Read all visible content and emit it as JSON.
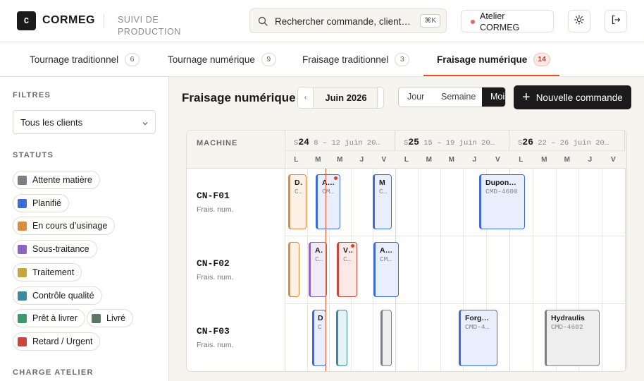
{
  "header": {
    "logo_letter": "C",
    "brand": "CORMEG",
    "subtitle_line1": "SUIVI DE",
    "subtitle_line2": "PRODUCTION",
    "search_placeholder": "Rechercher commande, client…",
    "search_shortcut": "⌘K",
    "workshop_line1": "Atelier",
    "workshop_line2": "CORMEG",
    "icons": [
      "search-icon",
      "sun-icon",
      "logout-icon"
    ]
  },
  "tabs": [
    {
      "label": "Tournage traditionnel",
      "count": "6",
      "active": false
    },
    {
      "label": "Tournage numérique",
      "count": "9",
      "active": false
    },
    {
      "label": "Fraisage traditionnel",
      "count": "3",
      "active": false
    },
    {
      "label": "Fraisage numérique",
      "count": "14",
      "active": true
    }
  ],
  "sidebar": {
    "filters_title": "FILTRES",
    "client_select": "Tous les clients",
    "statuses_title": "STATUTS",
    "statuses": [
      {
        "label": "Attente matière",
        "color": "#7a7f88"
      },
      {
        "label": "Planifié",
        "color": "#3d6bd9"
      },
      {
        "label": "En cours d’usinage",
        "color": "#e08a3c"
      },
      {
        "label": "Sous-traitance",
        "color": "#8e63c7"
      },
      {
        "label": "Traitement",
        "color": "#c9a43c"
      },
      {
        "label": "Contrôle qualité",
        "color": "#3c8aa0"
      },
      {
        "label": "Prêt à livrer",
        "color": "#3c9a6a"
      },
      {
        "label": "Livré",
        "color": "#5f7566"
      },
      {
        "label": "Retard / Urgent",
        "color": "#c9473a"
      }
    ],
    "load_title": "CHARGE ATELIER"
  },
  "main": {
    "title": "Fraisage numérique",
    "month_label": "Juin 2026",
    "prev_label": "‹",
    "views": [
      "Jour",
      "Semaine",
      "Mois"
    ],
    "active_view": "Mois",
    "new_button": "Nouvelle commande"
  },
  "gantt": {
    "machine_header": "MACHINE",
    "weeks": [
      {
        "prefix": "S",
        "num": "24",
        "range": "8 – 12 juin 20…"
      },
      {
        "prefix": "S",
        "num": "25",
        "range": "15 – 19 juin 20…"
      },
      {
        "prefix": "S",
        "num": "26",
        "range": "22 – 26 juin 20…"
      }
    ],
    "days": [
      "L",
      "M",
      "M",
      "J",
      "V"
    ],
    "machines": [
      {
        "code": "CN-F01",
        "type": "Frais. num."
      },
      {
        "code": "CN-F02",
        "type": "Frais. num."
      },
      {
        "code": "CN-F03",
        "type": "Frais. num."
      }
    ],
    "bars": [
      {
        "row": 0,
        "title": "D…",
        "code": "C…",
        "status": "orange"
      },
      {
        "row": 0,
        "title": "A…",
        "code": "CM…",
        "status": "blue",
        "alert": true
      },
      {
        "row": 0,
        "title": "M",
        "code": "C…",
        "status": "blue"
      },
      {
        "row": 0,
        "title": "Dupon…",
        "code": "CMD-4600",
        "status": "blue"
      },
      {
        "row": 1,
        "title": "",
        "code": "",
        "status": "orange"
      },
      {
        "row": 1,
        "title": "A…",
        "code": "C…",
        "status": "purple"
      },
      {
        "row": 1,
        "title": "V…",
        "code": "C…",
        "status": "red",
        "alert": true
      },
      {
        "row": 1,
        "title": "A…",
        "code": "CM…",
        "status": "blue"
      },
      {
        "row": 2,
        "title": "D",
        "code": "C",
        "status": "blue"
      },
      {
        "row": 2,
        "title": "",
        "code": "",
        "status": "teal"
      },
      {
        "row": 2,
        "title": "",
        "code": "",
        "status": "gray"
      },
      {
        "row": 2,
        "title": "Forg…",
        "code": "CMD-4…",
        "status": "blue"
      },
      {
        "row": 2,
        "title": "Hydraulis",
        "code": "CMD-4602",
        "status": "gray"
      }
    ]
  }
}
